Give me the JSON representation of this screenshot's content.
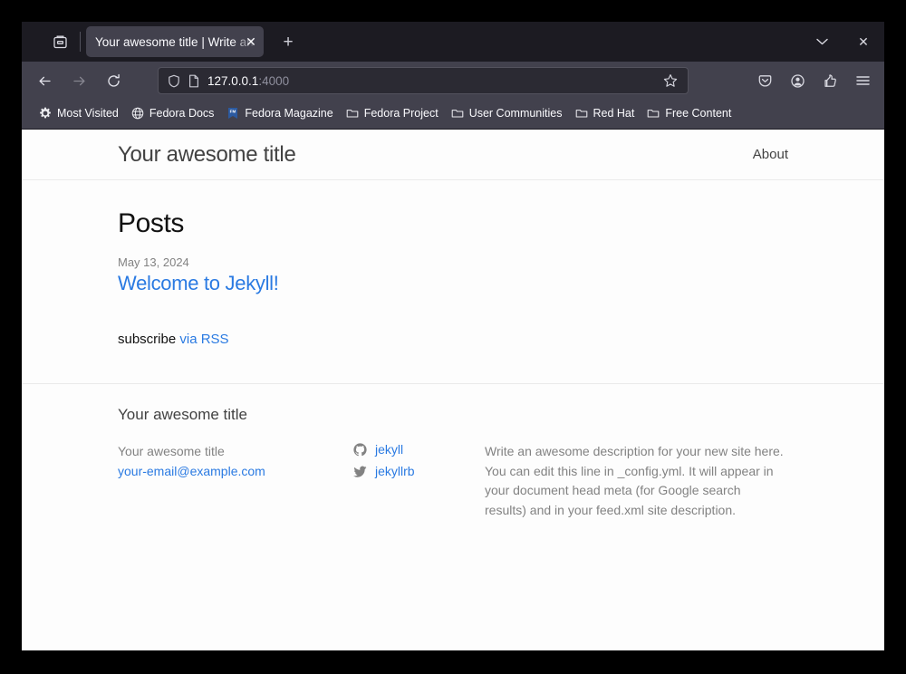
{
  "browser": {
    "firefox_view_icon": "firefox-view-icon",
    "tab": {
      "title": "Your awesome title | Write an",
      "close_label": "✕"
    },
    "new_tab_label": "+",
    "window_controls": {
      "list_tabs_label": "⌄",
      "close_label": "✕"
    },
    "nav": {
      "back_label": "back-icon",
      "forward_label": "forward-icon",
      "reload_label": "reload-icon"
    },
    "urlbar": {
      "shield_icon": "shield-icon",
      "page_icon": "page-icon",
      "host": "127.0.0.1",
      "port": ":4000",
      "bookmark_star": "star-icon"
    },
    "toolbar_right": [
      {
        "name": "pocket-icon",
        "label": "Save to Pocket"
      },
      {
        "name": "account-icon",
        "label": "Account"
      },
      {
        "name": "extensions-icon",
        "label": "Extensions"
      },
      {
        "name": "menu-icon",
        "label": "Open application menu"
      }
    ],
    "bookmarks": [
      {
        "label": "Most Visited",
        "icon": "gear-icon"
      },
      {
        "label": "Fedora Docs",
        "icon": "globe-icon"
      },
      {
        "label": "Fedora Magazine",
        "icon": "fedora-magazine-icon"
      },
      {
        "label": "Fedora Project",
        "icon": "folder-icon"
      },
      {
        "label": "User Communities",
        "icon": "folder-icon"
      },
      {
        "label": "Red Hat",
        "icon": "folder-icon"
      },
      {
        "label": "Free Content",
        "icon": "folder-icon"
      }
    ]
  },
  "site": {
    "title": "Your awesome title",
    "nav": [
      {
        "label": "About"
      }
    ],
    "main": {
      "heading": "Posts",
      "posts": [
        {
          "date": "May 13, 2024",
          "title": "Welcome to Jekyll!"
        }
      ],
      "subscribe_text": "subscribe",
      "subscribe_link": "via RSS"
    },
    "footer": {
      "heading": "Your awesome title",
      "owner": "Your awesome title",
      "email": "your-email@example.com",
      "social": [
        {
          "icon": "github-icon",
          "label": "jekyll"
        },
        {
          "icon": "twitter-icon",
          "label": "jekyllrb"
        }
      ],
      "description": "Write an awesome description for your new site here. You can edit this line in _config.yml. It will appear in your document head meta (for Google search results) and in your feed.xml site description."
    }
  },
  "colors": {
    "link": "#2a7ae2",
    "muted": "#828282",
    "chrome_dark": "#1c1b22",
    "chrome_toolbar": "#42414d"
  }
}
